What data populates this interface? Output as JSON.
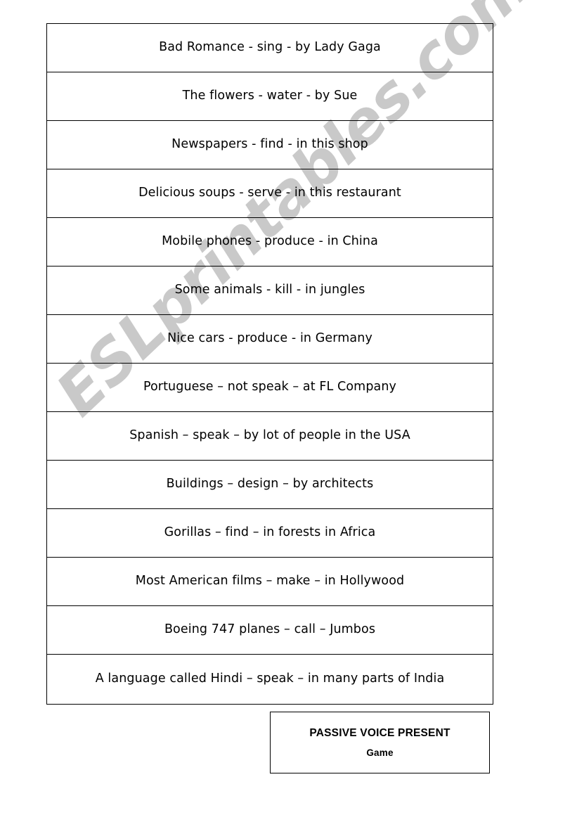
{
  "document": {
    "page_background": "#ffffff",
    "ink_color": "#000000"
  },
  "watermark": {
    "text": "ESLprintables.com",
    "color": "#c9c9c9"
  },
  "worksheet": {
    "rows": [
      {
        "text": "Bad Romance  - sing  - by Lady Gaga"
      },
      {
        "text": "The flowers  - water  -  by Sue"
      },
      {
        "text": "Newspapers  - find  - in this shop"
      },
      {
        "text": "Delicious soups  -  serve  - in this restaurant"
      },
      {
        "text": "Mobile phones  - produce  -  in China"
      },
      {
        "text": "Some animals  - kill -  in jungles"
      },
      {
        "text": "Nice cars  -  produce  -  in Germany"
      },
      {
        "text": "Portuguese  – not speak –  at FL Company"
      },
      {
        "text": "Spanish  – speak –  by lot of people in the USA"
      },
      {
        "text": "Buildings  – design –  by architects"
      },
      {
        "text": "Gorillas  – find –  in forests in Africa"
      },
      {
        "text": "Most American films  – make –  in Hollywood"
      },
      {
        "text": "Boeing 747 planes  – call –  Jumbos"
      },
      {
        "text": "A language called Hindi  – speak –  in many parts of India"
      }
    ]
  },
  "title_box": {
    "line1": "PASSIVE VOICE PRESENT",
    "line2": "Game"
  }
}
